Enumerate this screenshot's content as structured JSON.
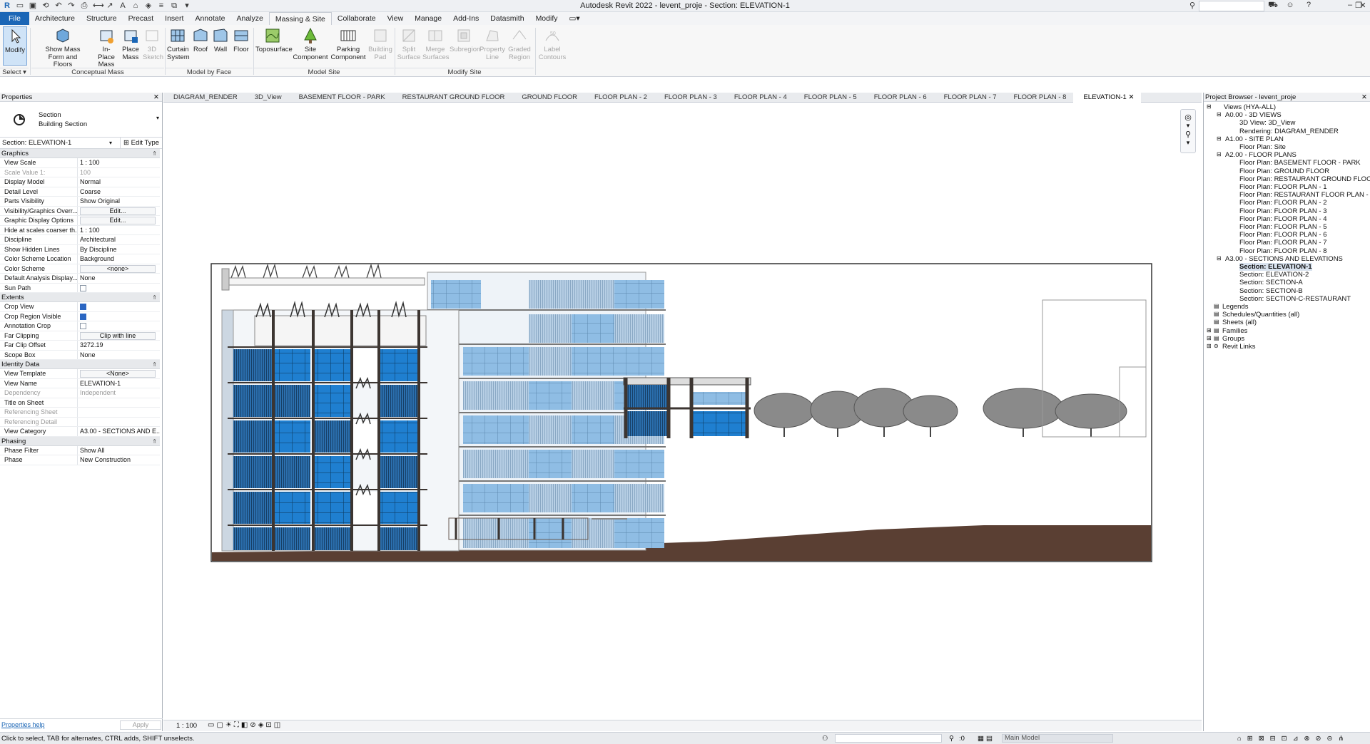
{
  "window": {
    "title": "Autodesk Revit 2022 - levent_proje - Section: ELEVATION-1"
  },
  "ribbon": {
    "tabs": [
      "File",
      "Architecture",
      "Structure",
      "Precast",
      "Insert",
      "Annotate",
      "Analyze",
      "Massing & Site",
      "Collaborate",
      "View",
      "Manage",
      "Add-Ins",
      "Datasmith",
      "Modify"
    ],
    "active_tab": "Massing & Site",
    "buttons": {
      "modify": "Modify",
      "show_mass_1": "Show Mass",
      "show_mass_2": "Form and Floors",
      "inplace_1": "In-Place",
      "inplace_2": "Mass",
      "place_1": "Place",
      "place_2": "Mass",
      "sketch_1": "3D",
      "sketch_2": "Sketch",
      "curtain_1": "Curtain",
      "curtain_2": "System",
      "roof": "Roof",
      "wall": "Wall",
      "floor": "Floor",
      "toposurface": "Toposurface",
      "site_comp_1": "Site",
      "site_comp_2": "Component",
      "parking_1": "Parking",
      "parking_2": "Component",
      "bpad_1": "Building",
      "bpad_2": "Pad",
      "split_1": "Split",
      "split_2": "Surface",
      "merge_1": "Merge",
      "merge_2": "Surfaces",
      "subregion": "Subregion",
      "propline_1": "Property",
      "propline_2": "Line",
      "graded_1": "Graded",
      "graded_2": "Region",
      "label_1": "Label",
      "label_2": "Contours"
    },
    "panels": {
      "select": "Select",
      "conceptual": "Conceptual Mass",
      "model_by_face": "Model by Face",
      "model_site": "Model Site",
      "modify_site": "Modify Site"
    }
  },
  "properties": {
    "header": "Properties",
    "type_line1": "Section",
    "type_line2": "Building Section",
    "instance": "Section: ELEVATION-1",
    "edit_type": "Edit Type",
    "groups": {
      "graphics": "Graphics",
      "extents": "Extents",
      "identity": "Identity Data",
      "phasing": "Phasing"
    },
    "graphics_rows": [
      {
        "k": "View Scale",
        "v": "1 : 100"
      },
      {
        "k": "Scale Value    1:",
        "v": "100"
      },
      {
        "k": "Display Model",
        "v": "Normal"
      },
      {
        "k": "Detail Level",
        "v": "Coarse"
      },
      {
        "k": "Parts Visibility",
        "v": "Show Original"
      },
      {
        "k": "Visibility/Graphics Overr...",
        "v": "Edit..."
      },
      {
        "k": "Graphic Display Options",
        "v": "Edit..."
      },
      {
        "k": "Hide at scales coarser th...",
        "v": "1 : 100"
      },
      {
        "k": "Discipline",
        "v": "Architectural"
      },
      {
        "k": "Show Hidden Lines",
        "v": "By Discipline"
      },
      {
        "k": "Color Scheme Location",
        "v": "Background"
      },
      {
        "k": "Color Scheme",
        "v": "<none>"
      },
      {
        "k": "Default Analysis Display...",
        "v": "None"
      },
      {
        "k": "Sun Path",
        "v": ""
      }
    ],
    "extents_rows": [
      {
        "k": "Crop View",
        "v": ""
      },
      {
        "k": "Crop Region Visible",
        "v": ""
      },
      {
        "k": "Annotation Crop",
        "v": ""
      },
      {
        "k": "Far Clipping",
        "v": "Clip with line"
      },
      {
        "k": "Far Clip Offset",
        "v": "3272.19"
      },
      {
        "k": "Scope Box",
        "v": "None"
      }
    ],
    "identity_rows": [
      {
        "k": "View Template",
        "v": "<None>"
      },
      {
        "k": "View Name",
        "v": "ELEVATION-1"
      },
      {
        "k": "Dependency",
        "v": "Independent"
      },
      {
        "k": "Title on Sheet",
        "v": ""
      },
      {
        "k": "Referencing Sheet",
        "v": ""
      },
      {
        "k": "Referencing Detail",
        "v": ""
      },
      {
        "k": "View Category",
        "v": "A3.00 - SECTIONS AND E..."
      }
    ],
    "phasing_rows": [
      {
        "k": "Phase Filter",
        "v": "Show All"
      },
      {
        "k": "Phase",
        "v": "New Construction"
      }
    ],
    "help": "Properties help",
    "apply": "Apply"
  },
  "view_tabs": [
    "DIAGRAM_RENDER",
    "3D_View",
    "BASEMENT FLOOR - PARK",
    "RESTAURANT GROUND FLOOR",
    "GROUND FLOOR",
    "FLOOR PLAN - 2",
    "FLOOR PLAN - 3",
    "FLOOR PLAN - 4",
    "FLOOR PLAN - 5",
    "FLOOR PLAN - 6",
    "FLOOR PLAN - 7",
    "FLOOR PLAN - 8",
    "ELEVATION-1"
  ],
  "project_browser": {
    "header": "Project Browser - levent_proje",
    "tree": [
      {
        "t": "Views (HYA-ALL)",
        "lvl": 0,
        "exp": "-"
      },
      {
        "t": "A0.00 - 3D VIEWS",
        "lvl": 1,
        "exp": "-"
      },
      {
        "t": "3D View: 3D_View",
        "lvl": 2
      },
      {
        "t": "Rendering: DIAGRAM_RENDER",
        "lvl": 2
      },
      {
        "t": "A1.00 - SITE PLAN",
        "lvl": 1,
        "exp": "-"
      },
      {
        "t": "Floor Plan: Site",
        "lvl": 2
      },
      {
        "t": "A2.00 - FLOOR PLANS",
        "lvl": 1,
        "exp": "-"
      },
      {
        "t": "Floor Plan: BASEMENT FLOOR - PARK",
        "lvl": 2
      },
      {
        "t": "Floor Plan: GROUND FLOOR",
        "lvl": 2
      },
      {
        "t": "Floor Plan: RESTAURANT GROUND FLOOR",
        "lvl": 2
      },
      {
        "t": "Floor Plan: FLOOR PLAN - 1",
        "lvl": 2
      },
      {
        "t": "Floor Plan: RESTAURANT FLOOR PLAN - 1",
        "lvl": 2
      },
      {
        "t": "Floor Plan: FLOOR PLAN - 2",
        "lvl": 2
      },
      {
        "t": "Floor Plan: FLOOR PLAN - 3",
        "lvl": 2
      },
      {
        "t": "Floor Plan: FLOOR PLAN - 4",
        "lvl": 2
      },
      {
        "t": "Floor Plan: FLOOR PLAN - 5",
        "lvl": 2
      },
      {
        "t": "Floor Plan: FLOOR PLAN - 6",
        "lvl": 2
      },
      {
        "t": "Floor Plan: FLOOR PLAN - 7",
        "lvl": 2
      },
      {
        "t": "Floor Plan: FLOOR PLAN - 8",
        "lvl": 2
      },
      {
        "t": "A3.00 - SECTIONS AND ELEVATIONS",
        "lvl": 1,
        "exp": "-"
      },
      {
        "t": "Section: ELEVATION-1",
        "lvl": 2,
        "sel": true
      },
      {
        "t": "Section: ELEVATION-2",
        "lvl": 2
      },
      {
        "t": "Section: SECTION-A",
        "lvl": 2
      },
      {
        "t": "Section: SECTION-B",
        "lvl": 2
      },
      {
        "t": "Section: SECTION-C-RESTAURANT",
        "lvl": 2
      },
      {
        "t": "Legends",
        "lvl": 0,
        "ico": true
      },
      {
        "t": "Schedules/Quantities (all)",
        "lvl": 0,
        "ico": true
      },
      {
        "t": "Sheets (all)",
        "lvl": 0,
        "ico": true
      },
      {
        "t": "Families",
        "lvl": 0,
        "exp": "+",
        "ico": true
      },
      {
        "t": "Groups",
        "lvl": 0,
        "exp": "+",
        "ico": true
      },
      {
        "t": "Revit Links",
        "lvl": 0,
        "exp": "+",
        "ico": true
      }
    ]
  },
  "view_control": {
    "scale": "1 : 100"
  },
  "status": {
    "hint": "Click to select, TAB for alternates, CTRL adds, SHIFT unselects.",
    "filter_count": ":0",
    "model": "Main Model"
  },
  "colors": {
    "accent": "#1b66b6",
    "glass_dark": "#1f7fd0",
    "glass_light": "#9fc6e8",
    "ground": "#5a3f33",
    "frame": "#3c3531"
  }
}
